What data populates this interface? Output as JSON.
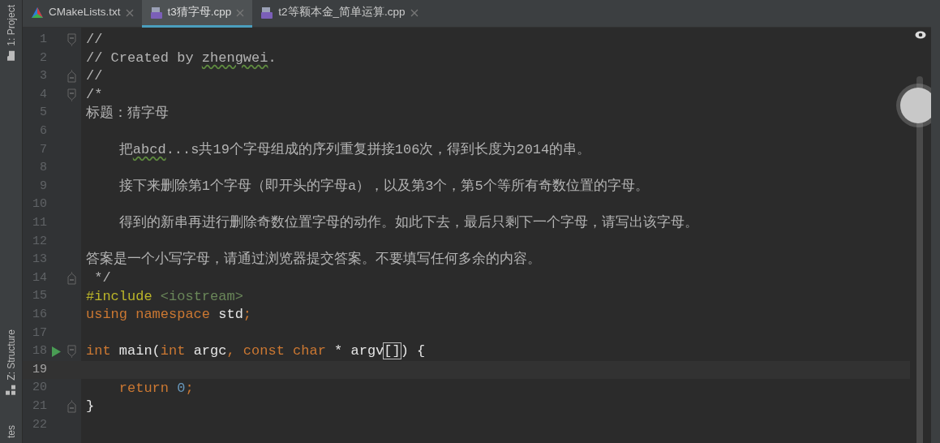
{
  "tool_windows": {
    "top": [
      {
        "label": "1: Project"
      }
    ],
    "bottom": [
      {
        "label": "Z: Structure"
      },
      {
        "label": "tes"
      }
    ]
  },
  "tabs": [
    {
      "label": "CMakeLists.txt",
      "kind": "cmake",
      "selected": false
    },
    {
      "label": "t3猜字母.cpp",
      "kind": "cpp",
      "selected": true
    },
    {
      "label": "t2等额本金_简单运算.cpp",
      "kind": "cpp",
      "selected": false
    }
  ],
  "editor": {
    "lines": [
      {
        "number": "1",
        "fold_start": true,
        "fold_end": false,
        "runnable": false,
        "current": false,
        "tokens": [
          {
            "text": "//",
            "kind": "comment"
          }
        ]
      },
      {
        "number": "2",
        "fold_start": false,
        "fold_end": false,
        "runnable": false,
        "current": false,
        "tokens": [
          {
            "text": "// Created by ",
            "kind": "comment"
          },
          {
            "text": "zhengwei",
            "kind": "comment",
            "typo": true
          },
          {
            "text": ".",
            "kind": "comment"
          }
        ]
      },
      {
        "number": "3",
        "fold_start": false,
        "fold_end": true,
        "runnable": false,
        "current": false,
        "tokens": [
          {
            "text": "//",
            "kind": "comment"
          }
        ]
      },
      {
        "number": "4",
        "fold_start": true,
        "fold_end": false,
        "runnable": false,
        "current": false,
        "tokens": [
          {
            "text": "/*",
            "kind": "comment"
          }
        ]
      },
      {
        "number": "5",
        "fold_start": false,
        "fold_end": false,
        "runnable": false,
        "current": false,
        "tokens": [
          {
            "text": "标题：猜字母",
            "kind": "comment"
          }
        ]
      },
      {
        "number": "6",
        "fold_start": false,
        "fold_end": false,
        "runnable": false,
        "current": false
      },
      {
        "number": "7",
        "fold_start": false,
        "fold_end": false,
        "runnable": false,
        "current": false,
        "tokens": [
          {
            "text": "    把",
            "kind": "comment"
          },
          {
            "text": "abcd",
            "kind": "comment",
            "typo": true
          },
          {
            "text": "...s共19个字母组成的序列重复拼接106次，得到长度为2014的串。",
            "kind": "comment"
          }
        ]
      },
      {
        "number": "8",
        "fold_start": false,
        "fold_end": false,
        "runnable": false,
        "current": false
      },
      {
        "number": "9",
        "fold_start": false,
        "fold_end": false,
        "runnable": false,
        "current": false,
        "tokens": [
          {
            "text": "    接下来删除第1个字母（即开头的字母a），以及第3个，第5个等所有奇数位置的字母。",
            "kind": "comment"
          }
        ]
      },
      {
        "number": "10",
        "fold_start": false,
        "fold_end": false,
        "runnable": false,
        "current": false
      },
      {
        "number": "11",
        "fold_start": false,
        "fold_end": false,
        "runnable": false,
        "current": false,
        "tokens": [
          {
            "text": "    得到的新串再进行删除奇数位置字母的动作。如此下去，最后只剩下一个字母，请写出该字母。",
            "kind": "comment"
          }
        ]
      },
      {
        "number": "12",
        "fold_start": false,
        "fold_end": false,
        "runnable": false,
        "current": false
      },
      {
        "number": "13",
        "fold_start": false,
        "fold_end": false,
        "runnable": false,
        "current": false,
        "tokens": [
          {
            "text": "答案是一个小写字母，请通过浏览器提交答案。不要填写任何多余的内容。",
            "kind": "comment"
          }
        ]
      },
      {
        "number": "14",
        "fold_start": false,
        "fold_end": true,
        "runnable": false,
        "current": false,
        "tokens": [
          {
            "text": " */",
            "kind": "comment"
          }
        ]
      },
      {
        "number": "15",
        "fold_start": false,
        "fold_end": false,
        "runnable": false,
        "current": false,
        "tokens": [
          {
            "text": "#include",
            "kind": "directive"
          },
          {
            "text": " <iostream>",
            "kind": "header"
          }
        ]
      },
      {
        "number": "16",
        "fold_start": false,
        "fold_end": false,
        "runnable": false,
        "current": false,
        "tokens": [
          {
            "text": "using namespace",
            "kind": "keyword"
          },
          {
            "text": " std",
            "kind": "plain"
          },
          {
            "text": ";",
            "kind": "keyword"
          }
        ]
      },
      {
        "number": "17",
        "fold_start": false,
        "fold_end": false,
        "runnable": false,
        "current": false
      },
      {
        "number": "18",
        "fold_start": true,
        "fold_end": false,
        "runnable": true,
        "current": false,
        "tokens": [
          {
            "text": "int",
            "kind": "keyword"
          },
          {
            "text": " main(",
            "kind": "plain"
          },
          {
            "text": "int",
            "kind": "keyword"
          },
          {
            "text": " argc",
            "kind": "plain"
          },
          {
            "text": ",",
            "kind": "keyword"
          },
          {
            "text": " const char",
            "kind": "keyword"
          },
          {
            "text": " * argv",
            "kind": "plain"
          },
          {
            "text": "[]",
            "kind": "match"
          },
          {
            "text": ") {",
            "kind": "plain"
          }
        ]
      },
      {
        "number": "19",
        "fold_start": false,
        "fold_end": false,
        "runnable": false,
        "current": true
      },
      {
        "number": "20",
        "fold_start": false,
        "fold_end": false,
        "runnable": false,
        "current": false,
        "tokens": [
          {
            "text": "    return",
            "kind": "keyword"
          },
          {
            "text": " 0",
            "kind": "number"
          },
          {
            "text": ";",
            "kind": "keyword"
          }
        ]
      },
      {
        "number": "21",
        "fold_start": false,
        "fold_end": true,
        "runnable": false,
        "current": false,
        "tokens": [
          {
            "text": "}",
            "kind": "plain"
          }
        ]
      },
      {
        "number": "22",
        "fold_start": false,
        "fold_end": false,
        "runnable": false,
        "current": false
      }
    ]
  }
}
